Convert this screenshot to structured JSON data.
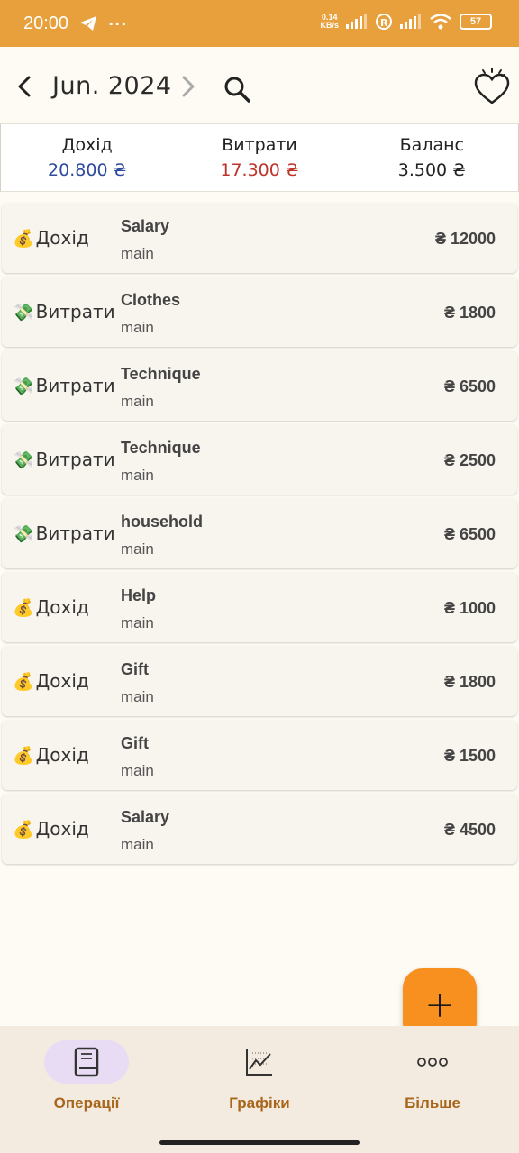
{
  "status": {
    "time": "20:00",
    "speed_top": "0.14",
    "speed_bottom": "KB/s",
    "battery": "57"
  },
  "header": {
    "month": "Jun. 2024"
  },
  "summary": {
    "income_label": "Дохід",
    "income_value": "20.800 ₴",
    "expense_label": "Витрати",
    "expense_value": "17.300 ₴",
    "balance_label": "Баланс",
    "balance_value": "3.500 ₴"
  },
  "transactions": [
    {
      "emoji": "💰",
      "type": "Дохід",
      "category": "Salary",
      "account": "main",
      "amount": "₴ 12000"
    },
    {
      "emoji": "💸",
      "type": "Витрати",
      "category": "Clothes",
      "account": "main",
      "amount": "₴ 1800"
    },
    {
      "emoji": "💸",
      "type": "Витрати",
      "category": "Technique",
      "account": "main",
      "amount": "₴ 6500"
    },
    {
      "emoji": "💸",
      "type": "Витрати",
      "category": "Technique",
      "account": "main",
      "amount": "₴ 2500"
    },
    {
      "emoji": "💸",
      "type": "Витрати",
      "category": "household",
      "account": "main",
      "amount": "₴ 6500"
    },
    {
      "emoji": "💰",
      "type": "Дохід",
      "category": "Help",
      "account": "main",
      "amount": "₴ 1000"
    },
    {
      "emoji": "💰",
      "type": "Дохід",
      "category": "Gift",
      "account": "main",
      "amount": "₴ 1800"
    },
    {
      "emoji": "💰",
      "type": "Дохід",
      "category": "Gift",
      "account": "main",
      "amount": "₴ 1500"
    },
    {
      "emoji": "💰",
      "type": "Дохід",
      "category": "Salary",
      "account": "main",
      "amount": "₴ 4500"
    }
  ],
  "fab": {
    "label": "+"
  },
  "nav": {
    "operations": "Операції",
    "charts": "Графіки",
    "more": "Більше"
  },
  "colors": {
    "accent": "#e8a03c",
    "fab": "#f7901e",
    "income": "#2e4a9e",
    "expense": "#c0332b",
    "nav_label": "#a8661c"
  },
  "icons": {
    "back": "chevron-left-icon",
    "next": "chevron-right-icon",
    "search": "search-icon",
    "heart": "heart-icon",
    "operations": "book-icon",
    "charts": "chart-icon",
    "more": "more-dots-icon"
  }
}
